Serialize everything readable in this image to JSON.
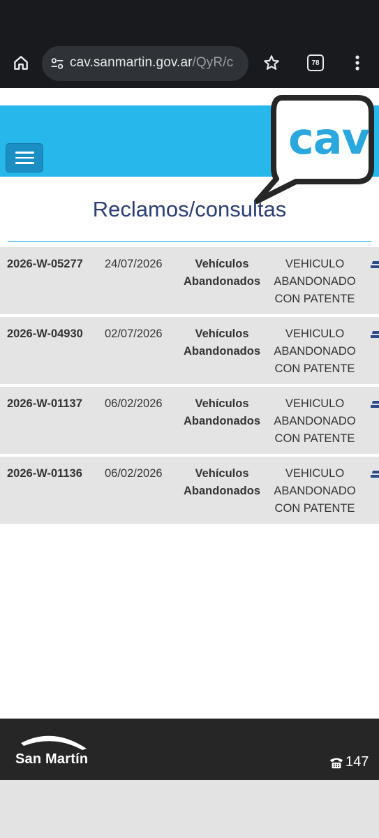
{
  "browser": {
    "url_host": "cav.sanmartin.gov.ar",
    "url_path": "/QyR/c",
    "tab_count": "78"
  },
  "header": {
    "logo_text": "cav"
  },
  "page": {
    "title": "Reclamos/consultas"
  },
  "claims": [
    {
      "id": "2026-W-05277",
      "date": "24/07/2026",
      "category_line1": "Vehículos",
      "category_line2": "Abandonados",
      "desc_line1": "VEHICULO",
      "desc_line2": "ABANDONADO",
      "desc_line3": "CON PATENTE"
    },
    {
      "id": "2026-W-04930",
      "date": "02/07/2026",
      "category_line1": "Vehículos",
      "category_line2": "Abandonados",
      "desc_line1": "VEHICULO",
      "desc_line2": "ABANDONADO",
      "desc_line3": "CON PATENTE"
    },
    {
      "id": "2026-W-01137",
      "date": "06/02/2026",
      "category_line1": "Vehículos",
      "category_line2": "Abandonados",
      "desc_line1": "VEHICULO",
      "desc_line2": "ABANDONADO",
      "desc_line3": "CON PATENTE"
    },
    {
      "id": "2026-W-01136",
      "date": "06/02/2026",
      "category_line1": "Vehículos",
      "category_line2": "Abandonados",
      "desc_line1": "VEHICULO",
      "desc_line2": "ABANDONADO",
      "desc_line3": "CON PATENTE"
    }
  ],
  "footer": {
    "brand": "San Martín",
    "phone": "147"
  },
  "colors": {
    "header_blue": "#27b8eb",
    "title_navy": "#2b3f76",
    "footer_dark": "#262626"
  }
}
